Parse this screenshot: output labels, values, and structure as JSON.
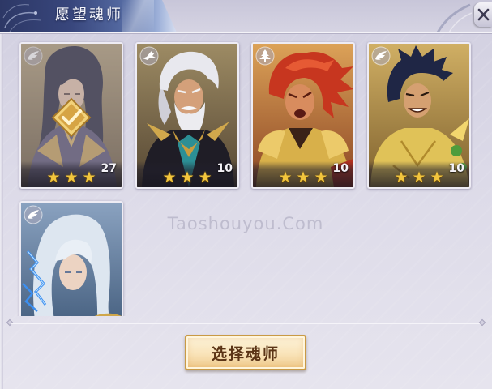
{
  "header": {
    "title": "愿望魂师",
    "close_icon": "close-icon"
  },
  "soul_masters": [
    {
      "emblem_icon": "wing-icon",
      "stars": 3,
      "level": "27",
      "selected": true
    },
    {
      "emblem_icon": "crane-icon",
      "stars": 3,
      "level": "10",
      "selected": false
    },
    {
      "emblem_icon": "tower-icon",
      "stars": 3,
      "level": "10",
      "selected": false
    },
    {
      "emblem_icon": "wing-icon",
      "stars": 3,
      "level": "10",
      "selected": false
    },
    {
      "emblem_icon": "wing-icon",
      "selected": false
    }
  ],
  "selection": {
    "check_icon": "checkmark-icon"
  },
  "actions": {
    "select_button_label": "选择魂师"
  },
  "watermark": "Taoshouyou.Com",
  "colors": {
    "title_bar": "#2d3866",
    "star": "#f2c53d",
    "button_border": "#c99a45",
    "button_text": "#5b3416"
  }
}
